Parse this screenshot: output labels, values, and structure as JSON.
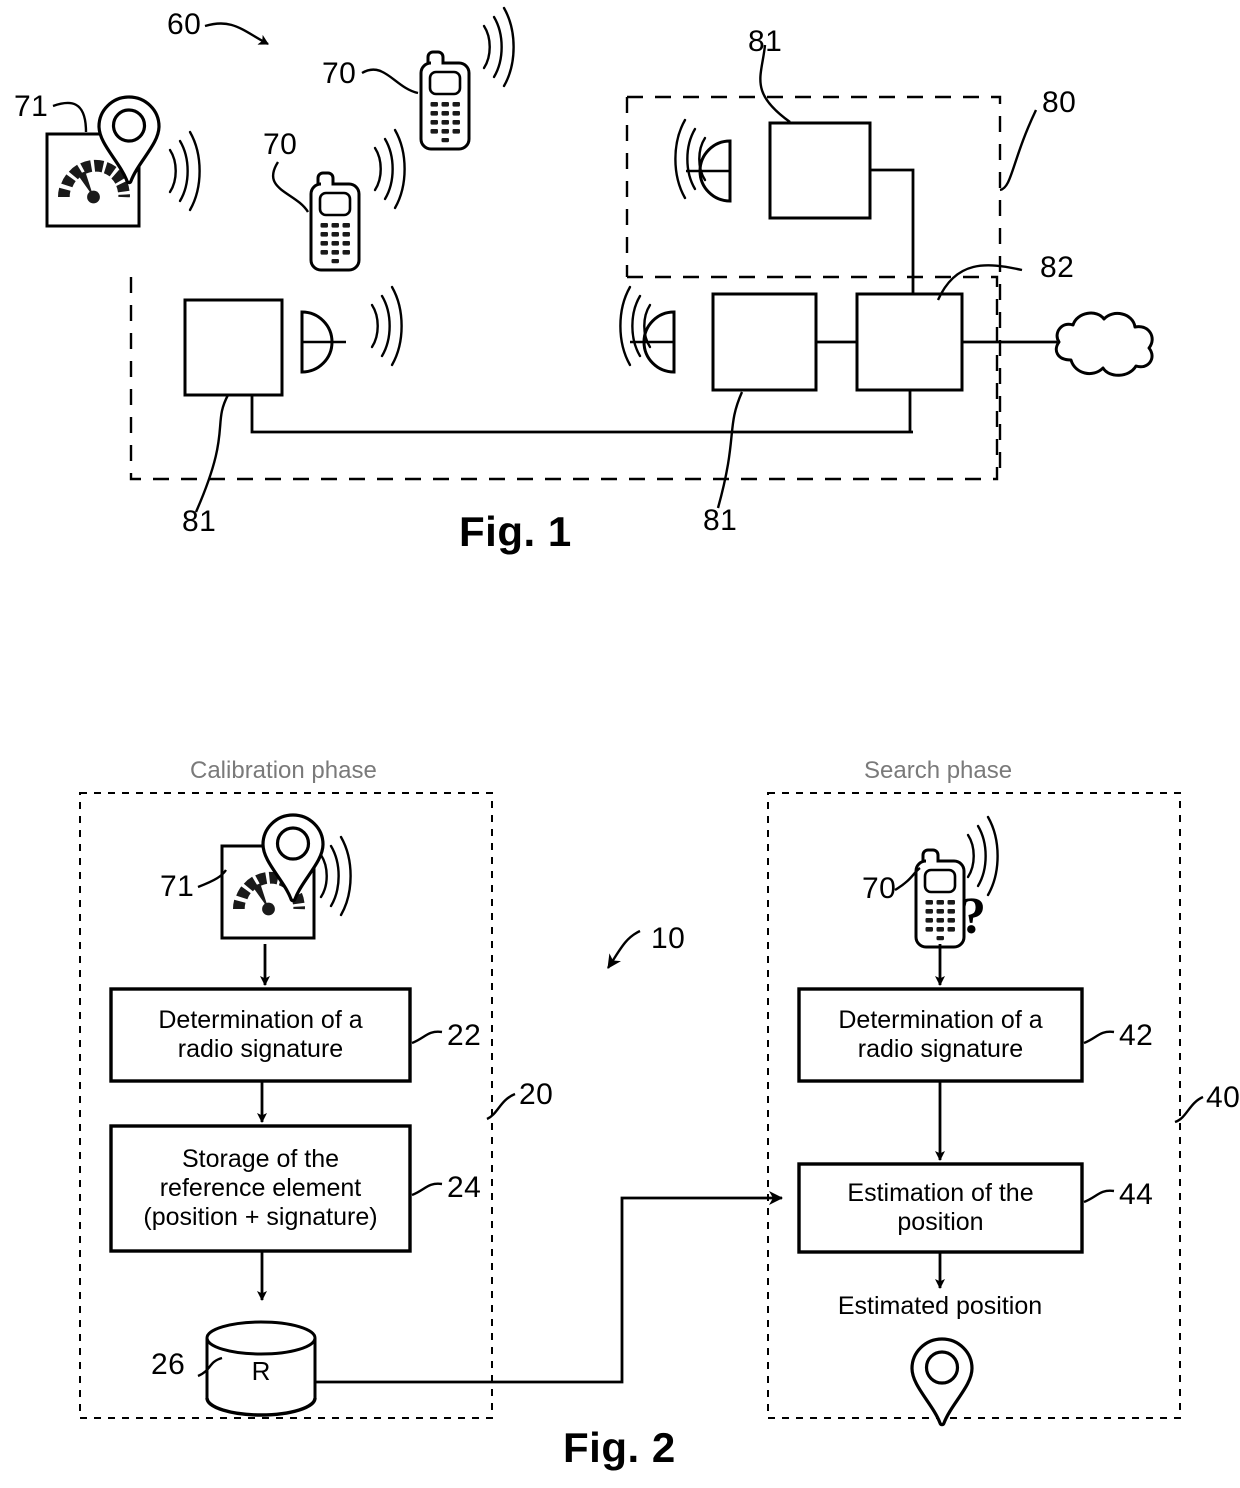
{
  "document": {
    "kind": "patent-drawing-sheet",
    "figures": [
      "Fig. 1",
      "Fig. 2"
    ]
  },
  "fig1": {
    "caption": "Fig. 1",
    "reference_numerals": {
      "system": "60",
      "mobile_terminal_a": "70",
      "mobile_terminal_b": "70",
      "reference_device": "71",
      "base_station_top": "81",
      "base_station_left": "81",
      "base_station_center": "81",
      "network_domain": "80",
      "core_node": "82"
    },
    "labels": [
      {
        "id": "n60",
        "text": "60"
      },
      {
        "id": "n71",
        "text": "71"
      },
      {
        "id": "n70a",
        "text": "70"
      },
      {
        "id": "n70b",
        "text": "70"
      },
      {
        "id": "n81top",
        "text": "81"
      },
      {
        "id": "n80",
        "text": "80"
      },
      {
        "id": "n82",
        "text": "82"
      },
      {
        "id": "n81left",
        "text": "81"
      },
      {
        "id": "n81mid",
        "text": "81"
      }
    ],
    "icons": {
      "gauge": "speedometer-icon",
      "map_pin": "map-pin-icon",
      "phone": "mobile-phone-icon",
      "antenna": "antenna-icon",
      "cloud": "network-cloud-icon",
      "waves": "radio-wave-icon"
    }
  },
  "fig2": {
    "caption": "Fig. 2",
    "overall_ref": "10",
    "calibration": {
      "title": "Calibration phase",
      "group_ref": "20",
      "device_ref": "71",
      "steps": [
        {
          "ref": "22",
          "text_lines": [
            "Determination of a",
            "radio signature"
          ]
        },
        {
          "ref": "24",
          "text_lines": [
            "Storage of the",
            "reference element",
            "(position + signature)"
          ]
        }
      ],
      "database": {
        "ref": "26",
        "label": "R"
      }
    },
    "search": {
      "title": "Search phase",
      "group_ref": "40",
      "device_ref": "70",
      "unknown_marker": "?",
      "steps": [
        {
          "ref": "42",
          "text_lines": [
            "Determination of a",
            "radio signature"
          ]
        },
        {
          "ref": "44",
          "text_lines": [
            "Estimation of the",
            "position"
          ]
        }
      ],
      "result_label": "Estimated position",
      "result_icon": "map-pin-icon"
    },
    "icons": {
      "gauge": "speedometer-icon",
      "map_pin": "map-pin-icon",
      "phone": "mobile-phone-icon",
      "database": "database-cylinder-icon",
      "waves": "radio-wave-icon",
      "arrow": "arrow-down-icon"
    }
  },
  "colors": {
    "ink": "#000000",
    "muted_text": "#7a7a7a",
    "paper": "#ffffff"
  }
}
